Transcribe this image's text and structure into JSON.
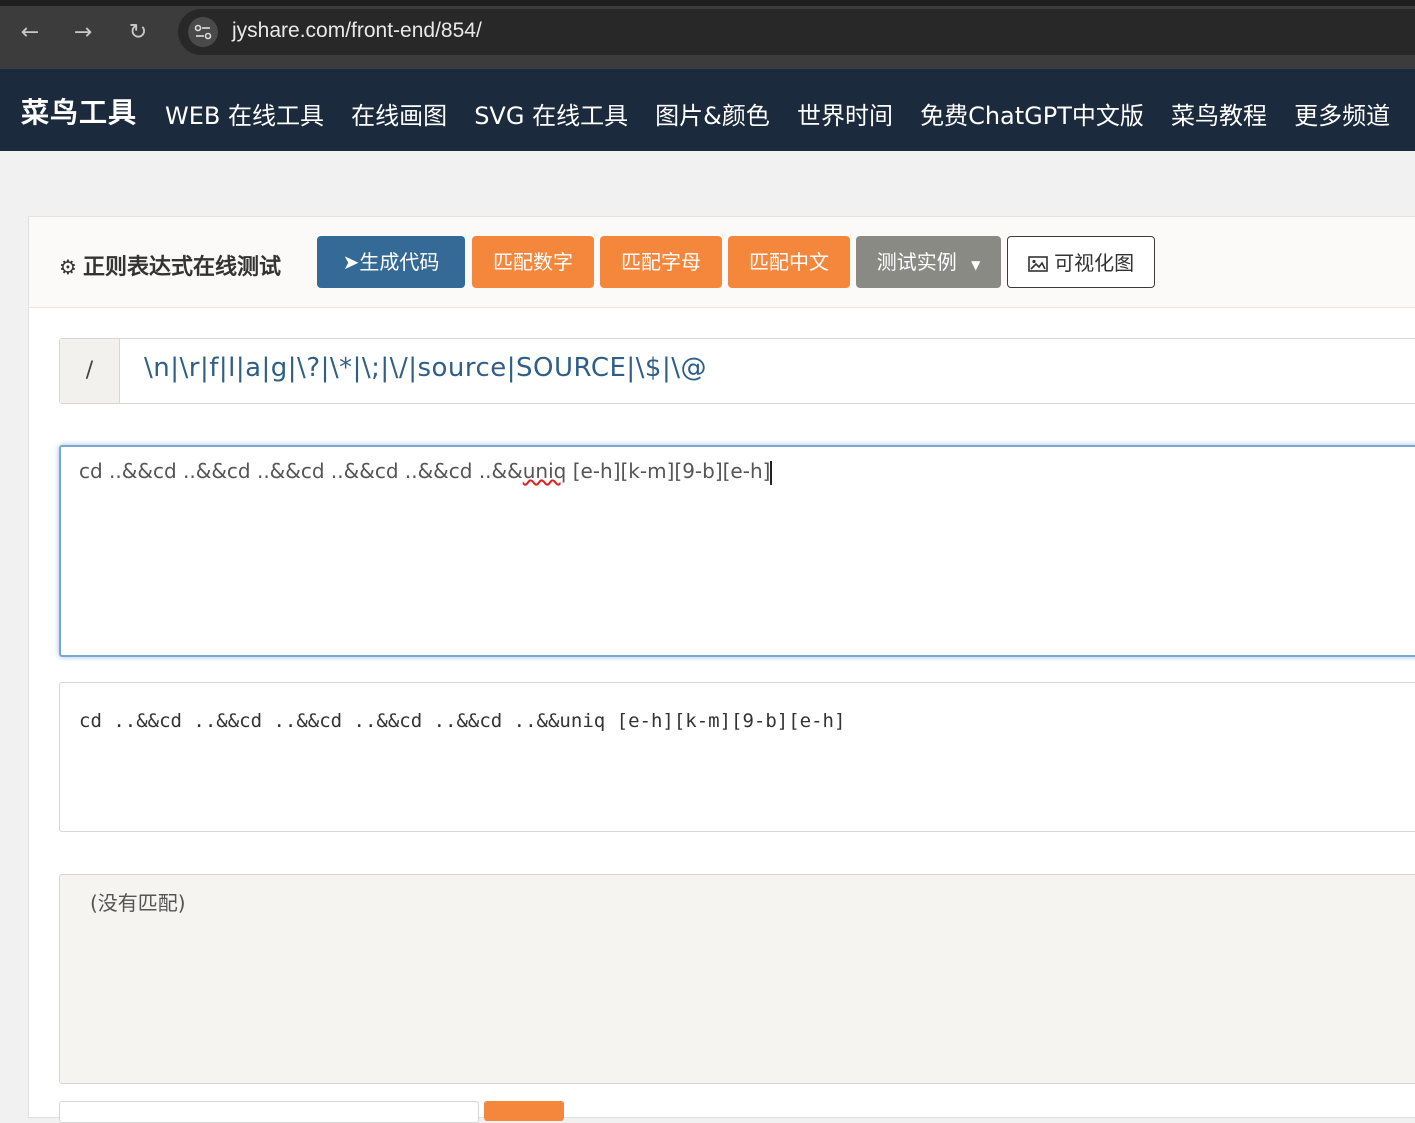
{
  "browser": {
    "url": "jyshare.com/front-end/854/",
    "back_icon": "←",
    "forward_icon": "→",
    "reload_icon": "↻"
  },
  "site_nav": {
    "logo": "菜鸟工具",
    "items": [
      "WEB 在线工具",
      "在线画图",
      "SVG 在线工具",
      "图片&颜色",
      "世界时间",
      "免费ChatGPT中文版",
      "菜鸟教程",
      "更多频道"
    ]
  },
  "card": {
    "title": "正则表达式在线测试",
    "buttons": {
      "generate": "生成代码",
      "match_digits": "匹配数字",
      "match_letters": "匹配字母",
      "match_chinese": "匹配中文",
      "examples": "测试实例",
      "visualize": "可视化图"
    },
    "regex": {
      "delimiter": "/",
      "value": "\\n|\\r|f|l|a|g|\\?|\\*|\\;|\\/|source|SOURCE|\\$|\\@"
    },
    "test_text": {
      "before": "cd ..&&cd ..&&cd ..&&cd ..&&cd ..&&cd ..&&",
      "misspelled": "uniq",
      "after": " [e-h][k-m][9-b][e-h]"
    },
    "result_text": "cd ..&&cd ..&&cd ..&&cd ..&&cd ..&&cd ..&&uniq [e-h][k-m][9-b][e-h]",
    "match_result": "(没有匹配)"
  },
  "colors": {
    "nav_bg": "#1b2a3d",
    "primary": "#356a96",
    "accent": "#f5873d",
    "gray_btn": "#8a8a84"
  }
}
